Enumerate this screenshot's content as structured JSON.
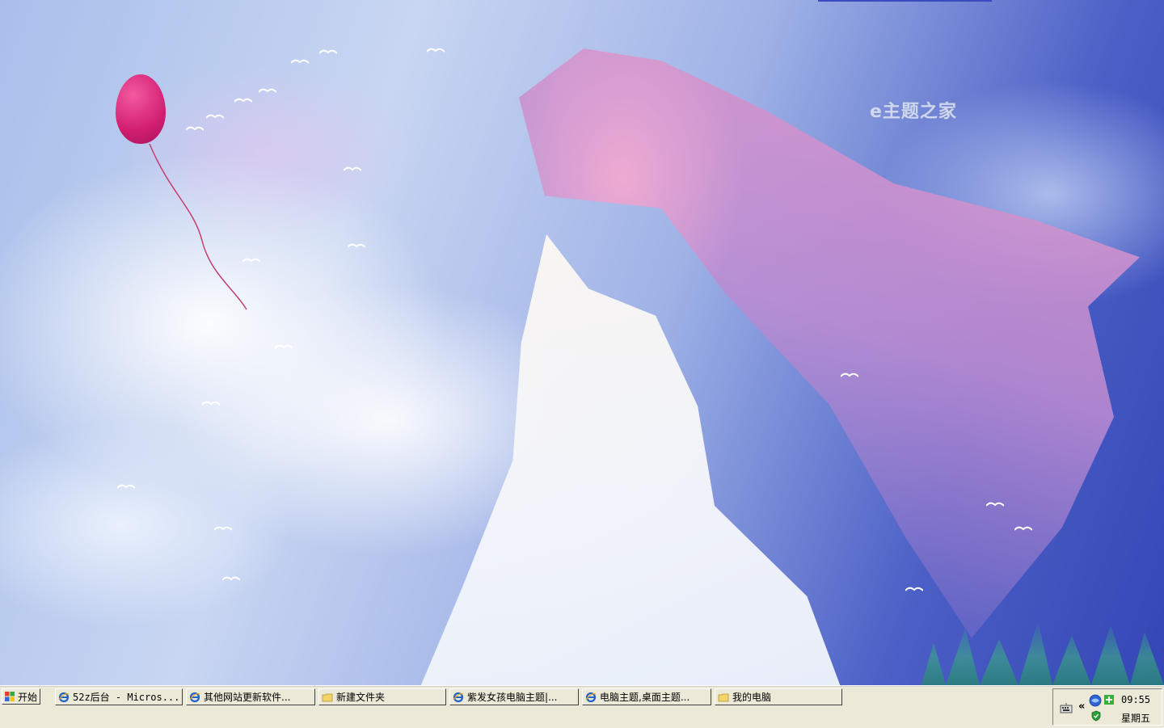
{
  "wallpaper": {
    "watermark": "e主题之家",
    "accent_pink": "#d21e72",
    "sky_blue": "#4b5fc6"
  },
  "taskbar": {
    "start_label": "开始",
    "start_icon": "windows-flag-icon",
    "buttons": [
      {
        "label": "52z后台 - Micros...",
        "icon": "internet-explorer-icon"
      },
      {
        "label": "其他网站更新软件...",
        "icon": "internet-explorer-icon"
      },
      {
        "label": "新建文件夹",
        "icon": "folder-icon"
      },
      {
        "label": "紫发女孩电脑主题|...",
        "icon": "internet-explorer-icon"
      },
      {
        "label": "电脑主题,桌面主题...",
        "icon": "internet-explorer-icon"
      },
      {
        "label": "我的电脑",
        "icon": "folder-icon"
      }
    ]
  },
  "tray": {
    "expand_label": "«",
    "time": "09:55",
    "day": "星期五",
    "icons": [
      "keyboard-icon",
      "network-globe-icon",
      "add-icon",
      "security-shield-icon"
    ]
  }
}
